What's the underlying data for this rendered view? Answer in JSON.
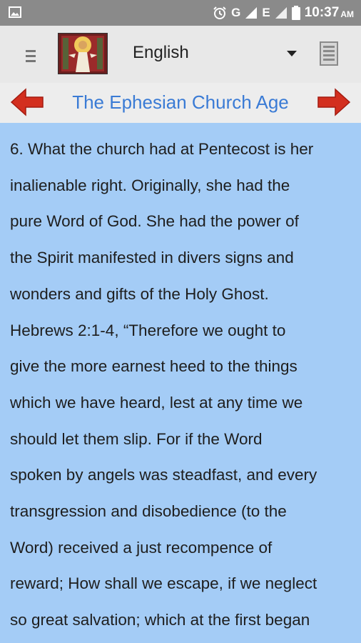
{
  "status_bar": {
    "time": "10:37",
    "ampm": "AM",
    "network": "G",
    "network2": "E"
  },
  "app_bar": {
    "language": "English"
  },
  "chapter": {
    "title": "The Ephesian Church Age"
  },
  "content": {
    "lines": [
      "6. What the church had at Pentecost is her",
      "inalienable right. Originally, she had the",
      "pure Word of God. She had the power of",
      "the Spirit manifested in divers signs and",
      "wonders and gifts of the Holy Ghost.",
      "Hebrews 2:1-4, “Therefore we ought to",
      "give the more earnest heed to the things",
      "which we have heard, lest at any time we",
      "should let them slip. For if the Word",
      "spoken by angels was steadfast, and every",
      "transgression and disobedience (to the",
      "Word) received a just recompence of",
      "reward; How shall we escape, if we neglect",
      "so great salvation; which at the first began"
    ]
  },
  "colors": {
    "status_bar": "#8a8a8a",
    "app_bar": "#e8e8e8",
    "title_text": "#3a7bd5",
    "arrow": "#d32f1f",
    "content_bg": "#a4ccf6"
  }
}
